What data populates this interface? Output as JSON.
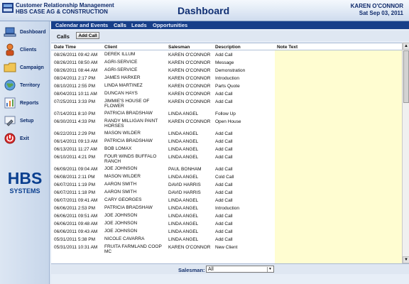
{
  "header": {
    "app_name": "Customer Relationship Management",
    "company": "HBS CASE AG & CONSTRUCTION",
    "page_title": "Dashboard",
    "user": "KAREN O'CONNOR",
    "date": "Sat Sep 03, 2011"
  },
  "sidebar": {
    "items": [
      {
        "label": "Dashboard",
        "icon": "laptop-icon"
      },
      {
        "label": "Clients",
        "icon": "person-icon"
      },
      {
        "label": "Campaign",
        "icon": "folder-icon"
      },
      {
        "label": "Territory",
        "icon": "globe-icon"
      },
      {
        "label": "Reports",
        "icon": "chart-icon"
      },
      {
        "label": "Setup",
        "icon": "wrench-icon"
      },
      {
        "label": "Exit",
        "icon": "power-icon"
      }
    ],
    "logo_text": "HBS",
    "logo_subtext": "SYSTEMS"
  },
  "tabs": [
    {
      "label": "Calendar and Events"
    },
    {
      "label": "Calls"
    },
    {
      "label": "Leads"
    },
    {
      "label": "Opportunities"
    }
  ],
  "calls": {
    "section_label": "Calls",
    "add_button": "Add Call"
  },
  "table": {
    "columns": [
      "Date Time",
      "Client",
      "Salesman",
      "Description",
      "Note Text"
    ],
    "rows": [
      {
        "dt": "08/26/2011 09:42 AM",
        "client": "DEREK ILLUM",
        "salesman": "KAREN O'CONNOR",
        "desc": "Add Call",
        "note": ""
      },
      {
        "dt": "08/26/2011 08:50 AM",
        "client": "AGRI-SERVICE",
        "salesman": "KAREN O'CONNOR",
        "desc": "Message",
        "note": ""
      },
      {
        "dt": "08/26/2011 08:44 AM",
        "client": "AGRI-SERVICE",
        "salesman": "KAREN O'CONNOR",
        "desc": "Demonstration",
        "note": ""
      },
      {
        "dt": "08/24/2011 2:17 PM",
        "client": "JAMES HARKER",
        "salesman": "KAREN O'CONNOR",
        "desc": "Introduction",
        "note": ""
      },
      {
        "dt": "08/10/2011 2:55 PM",
        "client": "LINDA MARTINEZ",
        "salesman": "KAREN O'CONNOR",
        "desc": "Parts Quote",
        "note": ""
      },
      {
        "dt": "08/04/2011 10:11 AM",
        "client": "DUNCAN HAYS",
        "salesman": "KAREN O'CONNOR",
        "desc": "Add Call",
        "note": ""
      },
      {
        "dt": "07/25/2011 3:33 PM",
        "client": "JIMMIE'S HOUSE OF FLOWER",
        "salesman": "KAREN O'CONNOR",
        "desc": "Add Call",
        "note": ""
      },
      {
        "dt": "07/14/2011 8:10 PM",
        "client": "PATRICIA BRADSHAW",
        "salesman": "LINDA ANGEL",
        "desc": "Follow Up",
        "note": ""
      },
      {
        "dt": "06/30/2011 4:33 PM",
        "client": "RANDY MILLIGAN PAINT HORSES",
        "salesman": "KAREN O'CONNOR",
        "desc": "Open House",
        "note": ""
      },
      {
        "dt": "06/22/2011 2:29 PM",
        "client": "MASON WILDER",
        "salesman": "LINDA ANGEL",
        "desc": "Add Call",
        "note": ""
      },
      {
        "dt": "06/14/2011 09:13 AM",
        "client": "PATRICIA BRADSHAW",
        "salesman": "LINDA ANGEL",
        "desc": "Add Call",
        "note": ""
      },
      {
        "dt": "06/13/2011 11:27 AM",
        "client": "BOB LOMAX",
        "salesman": "LINDA ANGEL",
        "desc": "Add Call",
        "note": ""
      },
      {
        "dt": "06/10/2011 4:21 PM",
        "client": "FOUR WINDS BUFFALO RANCH",
        "salesman": "LINDA ANGEL",
        "desc": "Add Call",
        "note": ""
      },
      {
        "dt": "06/09/2011 09:04 AM",
        "client": "JOE JOHNSON",
        "salesman": "PAUL BONHAM",
        "desc": "Add Call",
        "note": ""
      },
      {
        "dt": "06/08/2011 2:11 PM",
        "client": "MASON WILDER",
        "salesman": "LINDA ANGEL",
        "desc": "Cold Call",
        "note": ""
      },
      {
        "dt": "06/07/2011 1:19 PM",
        "client": "AARON SMITH",
        "salesman": "DAVID HARRIS",
        "desc": "Add Call",
        "note": ""
      },
      {
        "dt": "06/07/2011 1:18 PM",
        "client": "AARON SMITH",
        "salesman": "DAVID HARRIS",
        "desc": "Add Call",
        "note": ""
      },
      {
        "dt": "06/07/2011 09:41 AM",
        "client": "CARY GEORGES",
        "salesman": "LINDA ANGEL",
        "desc": "Add Call",
        "note": ""
      },
      {
        "dt": "06/06/2011 2:53 PM",
        "client": "PATRICIA BRADSHAW",
        "salesman": "LINDA ANGEL",
        "desc": "Introduction",
        "note": ""
      },
      {
        "dt": "06/06/2011 09:51 AM",
        "client": "JOE JOHNSON",
        "salesman": "LINDA ANGEL",
        "desc": "Add Call",
        "note": ""
      },
      {
        "dt": "06/06/2011 09:48 AM",
        "client": "JOE JOHNSON",
        "salesman": "LINDA ANGEL",
        "desc": "Add Call",
        "note": ""
      },
      {
        "dt": "06/06/2011 09:43 AM",
        "client": "JOE JOHNSON",
        "salesman": "LINDA ANGEL",
        "desc": "Add Call",
        "note": ""
      },
      {
        "dt": "05/31/2011 5:38 PM",
        "client": "NICOLE CAVARRA",
        "salesman": "LINDA ANGEL",
        "desc": "Add Call",
        "note": ""
      },
      {
        "dt": "05/31/2011 10:31 AM",
        "client": "FRUITA FARMLAND COOP MC",
        "salesman": "KAREN O'CONNOR",
        "desc": "New Client",
        "note": ""
      }
    ]
  },
  "footer": {
    "label": "Salesman:",
    "selected": "All"
  },
  "colors": {
    "tab_bar": "#173f89",
    "note_column": "#fffdd1",
    "title": "#102f73"
  }
}
